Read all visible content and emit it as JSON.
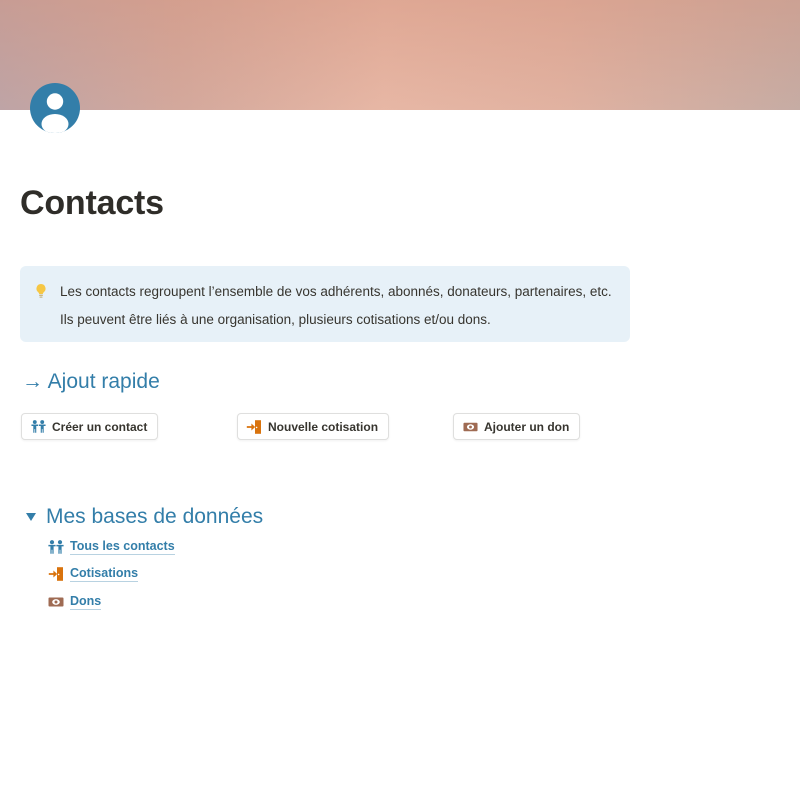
{
  "theme": {
    "accent": "#337ea9",
    "text": "#37352f",
    "title": "#2f2d29",
    "callout_bg": "#e7f1f8",
    "orange": "#d9730d",
    "brown": "#9f6b53",
    "bulb": "#f6c744"
  },
  "page": {
    "icon": "person-avatar-icon",
    "title": "Contacts"
  },
  "callout": {
    "icon": "lightbulb-icon",
    "lines": [
      "Les contacts regroupent l’ensemble de vos adhérents, abonnés, donateurs, partenaires, etc.",
      "Ils peuvent être liés à une organisation, plusieurs cotisations et/ou dons."
    ]
  },
  "quick_add": {
    "heading": "→ Ajout rapide",
    "buttons": [
      {
        "label": "Créer un contact",
        "icon": "people-icon"
      },
      {
        "label": "Nouvelle cotisation",
        "icon": "enter-door-icon"
      },
      {
        "label": "Ajouter un don",
        "icon": "banknote-icon"
      }
    ]
  },
  "databases": {
    "toggle_icon": "triangle-down-icon",
    "expanded": true,
    "heading": "Mes bases de données",
    "items": [
      {
        "label": "Tous les contacts",
        "icon": "people-icon"
      },
      {
        "label": "Cotisations",
        "icon": "enter-door-icon"
      },
      {
        "label": "Dons",
        "icon": "banknote-icon"
      }
    ]
  }
}
